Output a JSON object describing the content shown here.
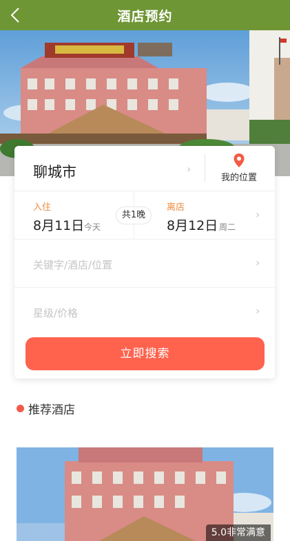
{
  "header": {
    "title": "酒店预约",
    "back_icon": "chevron-left-icon"
  },
  "search": {
    "city": "聊城市",
    "location_label": "我的位置",
    "checkin_label": "入住",
    "checkin_date": "8月11日",
    "checkin_day": "今天",
    "nights": "共1晚",
    "checkout_label": "离店",
    "checkout_date": "8月12日",
    "checkout_day": "周二",
    "keyword_placeholder": "关键字/酒店/位置",
    "star_price_placeholder": "星级/价格",
    "button_label": "立即搜索"
  },
  "recommend": {
    "title": "推荐酒店",
    "rating": "5.0非常满意"
  },
  "colors": {
    "header": "#6f9635",
    "accent_orange": "#f08a3a",
    "button": "#ff624d",
    "dot": "#f35a4c",
    "pin": "#f45a45"
  }
}
